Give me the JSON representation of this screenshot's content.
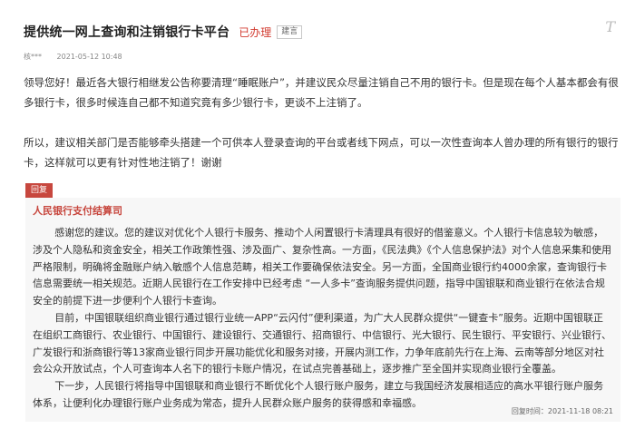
{
  "header": {
    "title": "提供统一网上查询和注销银行卡平台",
    "status": "已办理",
    "badge": "建言",
    "corner_icon": "T-icon"
  },
  "meta": {
    "author": "核***",
    "timestamp": "2021-05-12 10:48"
  },
  "question": {
    "paragraphs": [
      "领导您好！最近各大银行相继发公告称要清理“睡眠账户”，并建议民众尽量注销自己不用的银行卡。但是现在每个人基本都会有很多银行卡，很多时候连自己都不知道究竟有多少银行卡，更谈不上注销了。",
      "所以，建议相关部门是否能够牵头搭建一个可供本人登录查询的平台或者线下网点，可以一次性查询本人曾办理的所有银行的银行卡，这样就可以更有针对性地注销了！谢谢"
    ]
  },
  "reply": {
    "tag": "回复",
    "org": "人民银行支付结算司",
    "paragraphs": [
      "感谢您的建议。您的建议对优化个人银行卡服务、推动个人闲置银行卡清理具有很好的借鉴意义。个人银行卡信息较为敏感，涉及个人隐私和资金安全，相关工作政策性强、涉及面广、复杂性高。一方面，《民法典》《个人信息保护法》对个人信息采集和使用严格限制，明确将金融账户纳入敏感个人信息范畴，相关工作要确保依法安全。另一方面，全国商业银行约4000余家，查询银行卡信息需要统一相关规范。近期人民银行在工作安排中已经考虑 “一人多卡”查询服务提供问题，指导中国银联和商业银行在依法合规安全的前提下进一步便利个人银行卡查询。",
      "目前，中国银联组织商业银行通过银行业统一APP“云闪付”便利渠道，为广大人民群众提供“一键查卡”服务。近期中国银联正在组织工商银行、农业银行、中国银行、建设银行、交通银行、招商银行、中信银行、光大银行、民生银行、平安银行、兴业银行、广发银行和浙商银行等13家商业银行同步开展功能优化和服务对接，开展内测工作，力争年底前先行在上海、云南等部分地区对社会公众开放试点，个人可查询本人名下的银行卡账户情况，在试点完善基础上，逐步推广至全国并实现商业银行全覆盖。",
      "下一步，人民银行将指导中国银联和商业银行不断优化个人银行账户服务，建立与我国经济发展相适应的高水平银行账户服务体系，让便利化办理银行账户业务成为常态，提升人民群众账户服务的获得感和幸福感。"
    ],
    "date": "回复时间：2021-11-18 08:21"
  }
}
